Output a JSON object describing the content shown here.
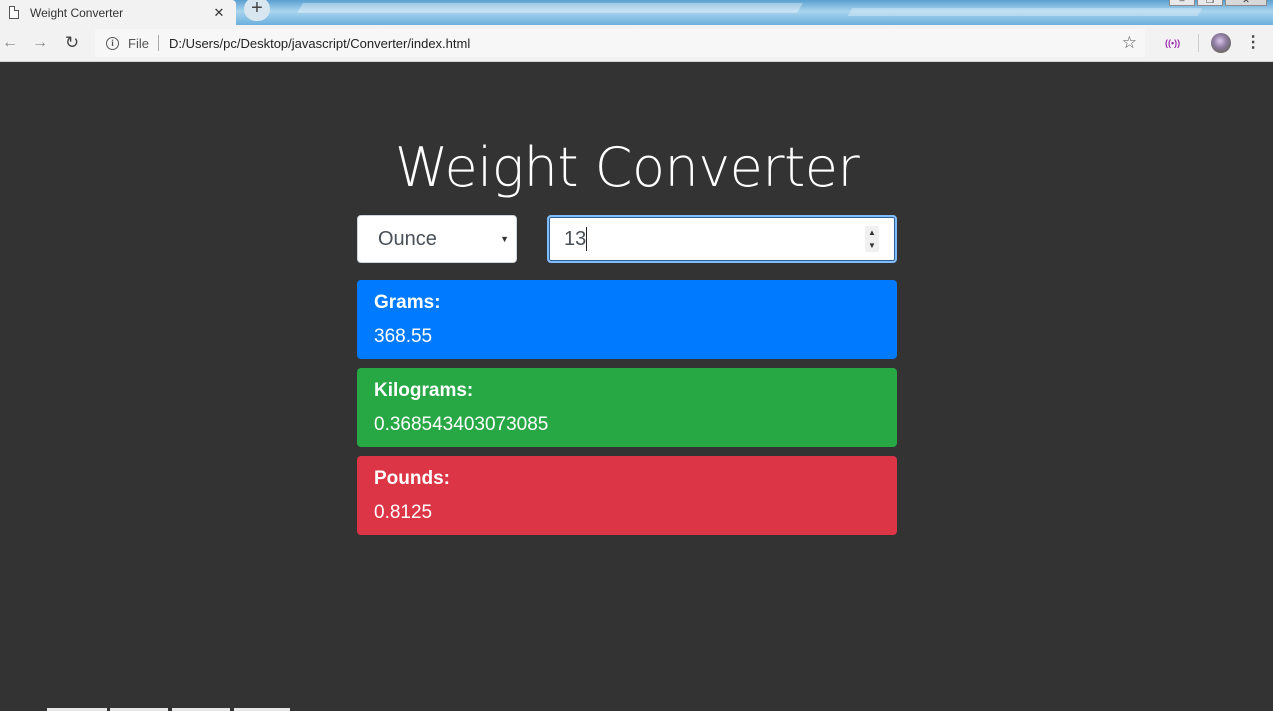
{
  "browser": {
    "tab_title": "Weight Converter",
    "tab_close": "✕",
    "new_tab": "+",
    "window_controls": [
      "–",
      "❐",
      "✕"
    ],
    "scheme_label": "File",
    "url": "D:/Users/pc/Desktop/javascript/Converter/index.html"
  },
  "app": {
    "title": "Weight Converter",
    "unit_select": {
      "value": "Ounce"
    },
    "input": {
      "value": "13"
    },
    "results": [
      {
        "label": "Grams:",
        "value": "368.55",
        "color": "#007bff"
      },
      {
        "label": "Kilograms:",
        "value": "0.368543403073085",
        "color": "#28a745"
      },
      {
        "label": "Pounds:",
        "value": "0.8125",
        "color": "#dc3545"
      }
    ]
  },
  "colors": {
    "page_background": "#333333",
    "input_focus_border": "#80bdff"
  }
}
